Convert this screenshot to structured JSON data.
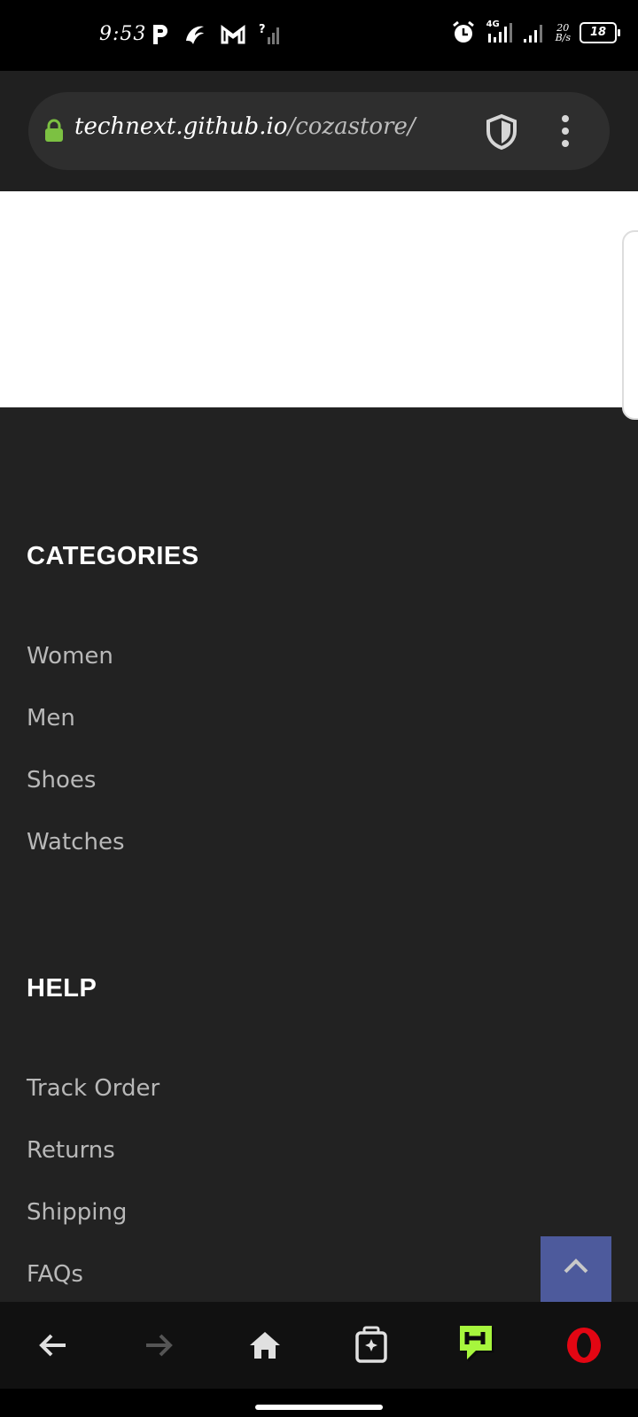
{
  "status_bar": {
    "time": "9:53",
    "network_label": "4G",
    "speed_value": "20",
    "speed_unit": "B/s",
    "battery": "18"
  },
  "browser": {
    "url_host": "technext.github.io",
    "url_path": "/cozastore/"
  },
  "footer": {
    "categories": {
      "heading": "CATEGORIES",
      "links": [
        "Women",
        "Men",
        "Shoes",
        "Watches"
      ]
    },
    "help": {
      "heading": "HELP",
      "links": [
        "Track Order",
        "Returns",
        "Shipping",
        "FAQs"
      ]
    }
  },
  "colors": {
    "footer_bg": "#222222",
    "back_to_top": "#4d5a9c",
    "lock_green": "#7cc142",
    "opera_red": "#e30613",
    "flow_green": "#a7f63d"
  },
  "icons": {
    "back": "arrow-left-icon",
    "forward": "arrow-right-icon",
    "home": "home-icon",
    "tabs": "tabs-icon",
    "flow": "my-flow-icon",
    "opera": "opera-logo-icon",
    "shield": "shield-icon",
    "menu": "more-vertical-icon",
    "back_to_top": "chevron-up-icon"
  }
}
